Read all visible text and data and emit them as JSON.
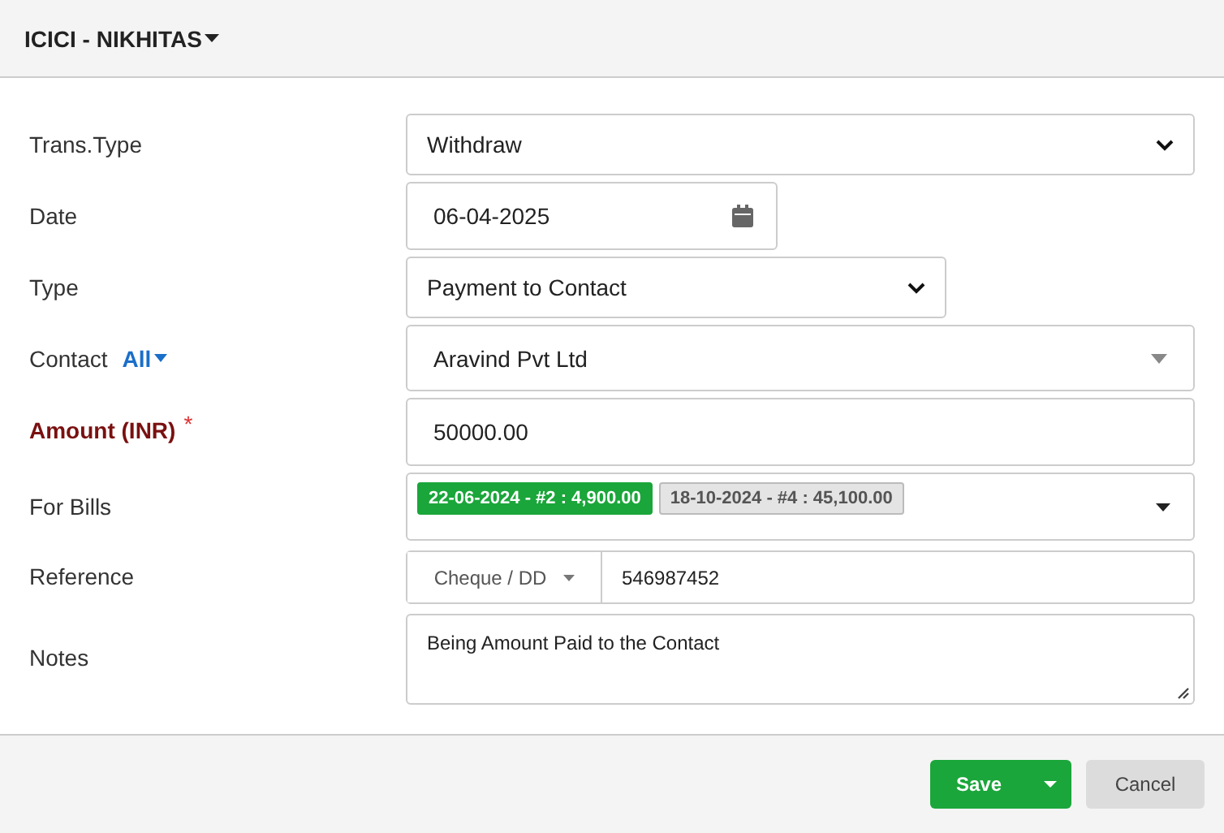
{
  "header": {
    "title": "ICICI - NIKHITAS"
  },
  "fields": [
    {
      "kind": "select",
      "label": "Trans.Type",
      "value": "Withdraw"
    },
    {
      "kind": "date",
      "label": "Date",
      "value": "06-04-2025"
    },
    {
      "kind": "short-select",
      "label": "Type",
      "value": "Payment to Contact"
    },
    {
      "kind": "combobox",
      "label": "Contact",
      "filter": "All",
      "value": "Aravind Pvt Ltd"
    },
    {
      "kind": "input",
      "label": "Amount (INR)",
      "required_mark": "*",
      "value": "50000.00"
    },
    {
      "kind": "tags",
      "label": "For Bills",
      "tags": [
        {
          "text": "22-06-2024 - #2 : 4,900.00",
          "selected": true
        },
        {
          "text": "18-10-2024 - #4 : 45,100.00",
          "selected": false
        }
      ]
    },
    {
      "kind": "reference",
      "label": "Reference",
      "mode": "Cheque / DD",
      "value": "546987452"
    },
    {
      "kind": "textarea",
      "label": "Notes",
      "value": "Being Amount Paid to the Contact"
    }
  ],
  "buttons": {
    "save": "Save",
    "cancel": "Cancel"
  }
}
